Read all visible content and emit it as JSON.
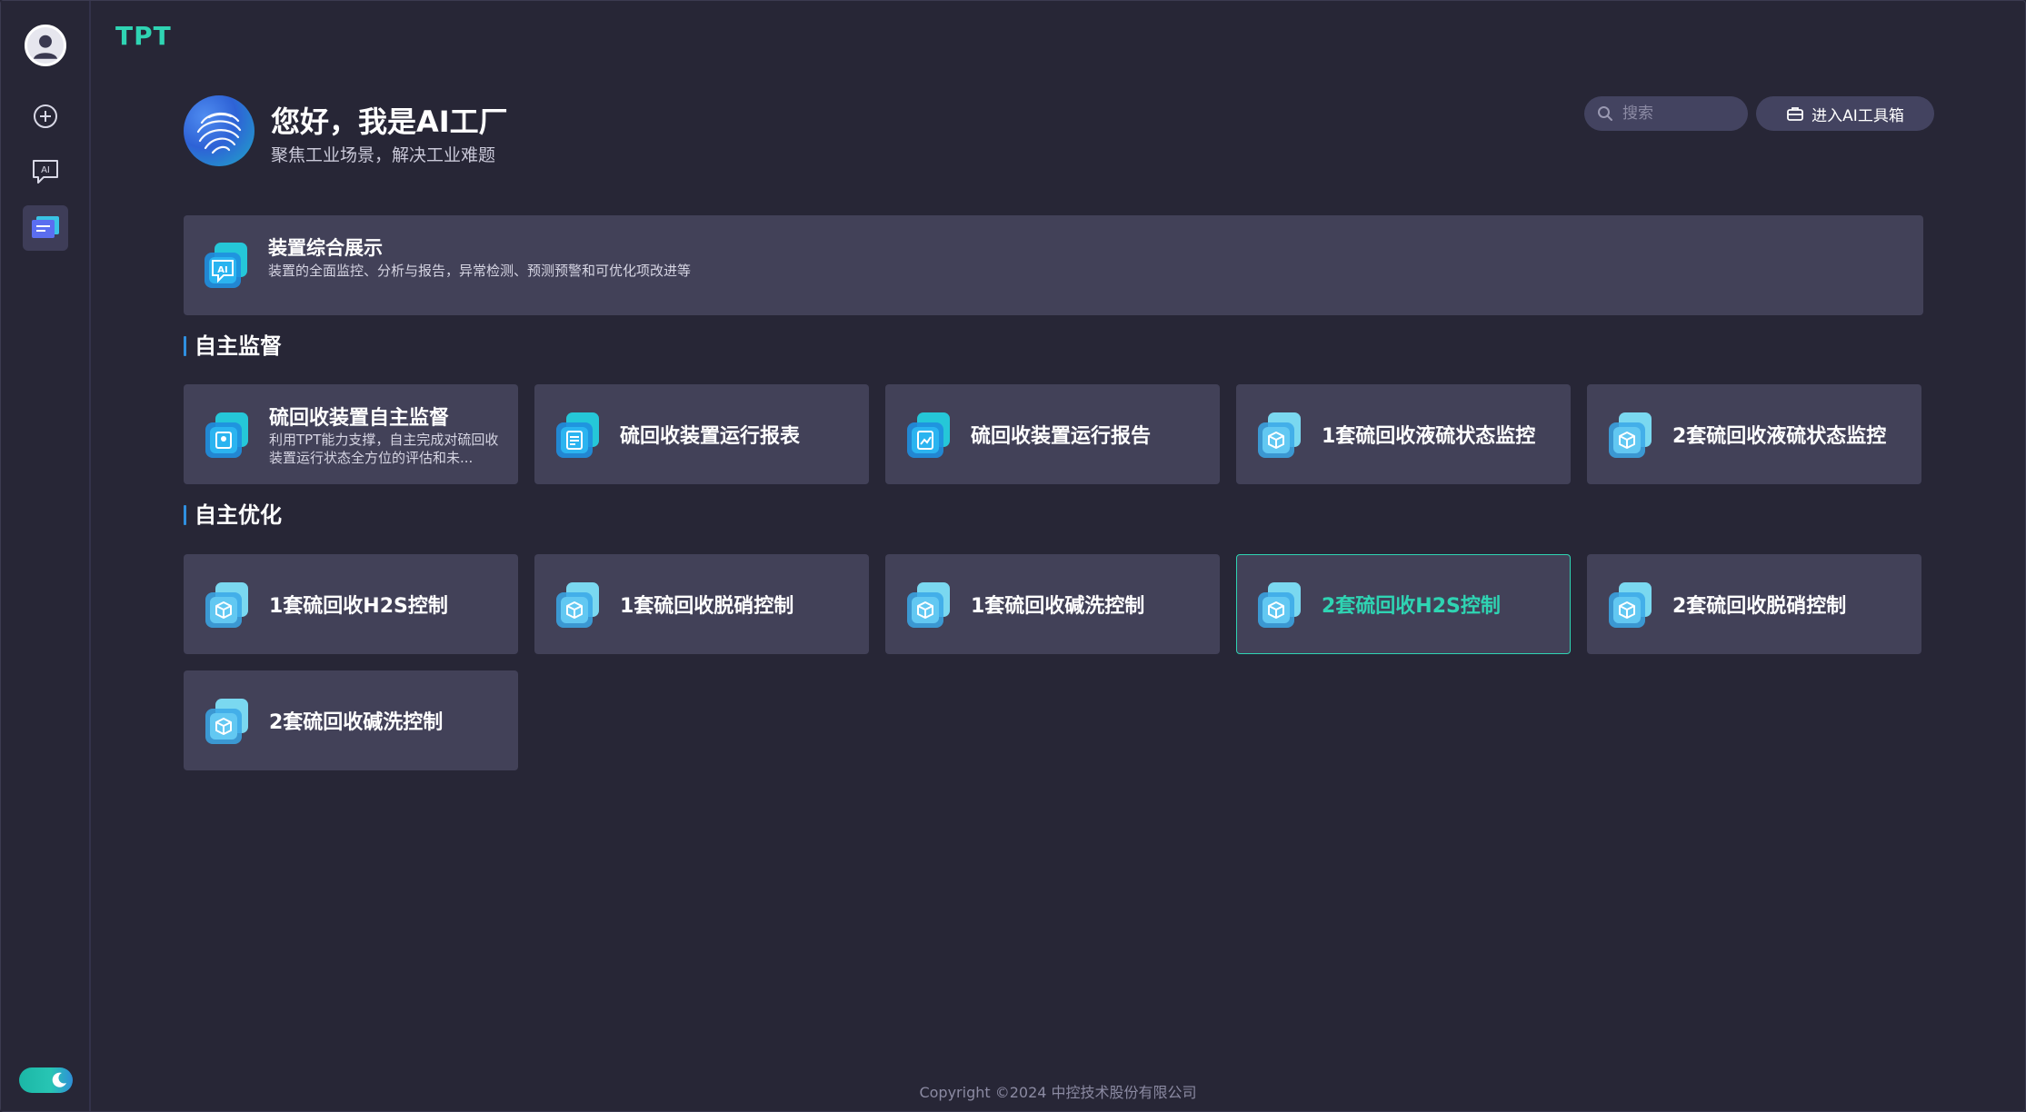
{
  "brand": "TPT",
  "hero": {
    "title": "您好，我是AI工厂",
    "subtitle": "聚焦工业场景，解决工业难题"
  },
  "search": {
    "placeholder": "搜索"
  },
  "toolbox_button": "进入AI工具箱",
  "banner": {
    "title": "装置综合展示",
    "desc": "装置的全面监控、分析与报告，异常检测、预测预警和可优化项改进等",
    "icon": "ai-chip-icon"
  },
  "sections": [
    {
      "title": "自主监督",
      "cards": [
        {
          "title": "硫回收装置自主监督",
          "desc": "利用TPT能力支撑，自主完成对硫回收装置运行状态全方位的评估和未...",
          "icon": "monitor-icon"
        },
        {
          "title": "硫回收装置运行报表",
          "icon": "report-icon"
        },
        {
          "title": "硫回收装置运行报告",
          "icon": "report-chart-icon"
        },
        {
          "title": "1套硫回收液硫状态监控",
          "icon": "cube-icon"
        },
        {
          "title": "2套硫回收液硫状态监控",
          "icon": "cube-icon"
        }
      ]
    },
    {
      "title": "自主优化",
      "cards": [
        {
          "title": "1套硫回收H2S控制",
          "icon": "cube-icon"
        },
        {
          "title": "1套硫回收脱硝控制",
          "icon": "cube-icon"
        },
        {
          "title": "1套硫回收碱洗控制",
          "icon": "cube-icon"
        },
        {
          "title": "2套硫回收H2S控制",
          "icon": "cube-icon",
          "active": true
        },
        {
          "title": "2套硫回收脱硝控制",
          "icon": "cube-icon"
        },
        {
          "title": "2套硫回收碱洗控制",
          "icon": "cube-icon"
        }
      ]
    }
  ],
  "footer": "Copyright ©2024 中控技术股份有限公司",
  "colors": {
    "background": "#272636",
    "card": "#424158",
    "accent": "#2fd4b3",
    "section_bar": "#2f8fe0"
  }
}
